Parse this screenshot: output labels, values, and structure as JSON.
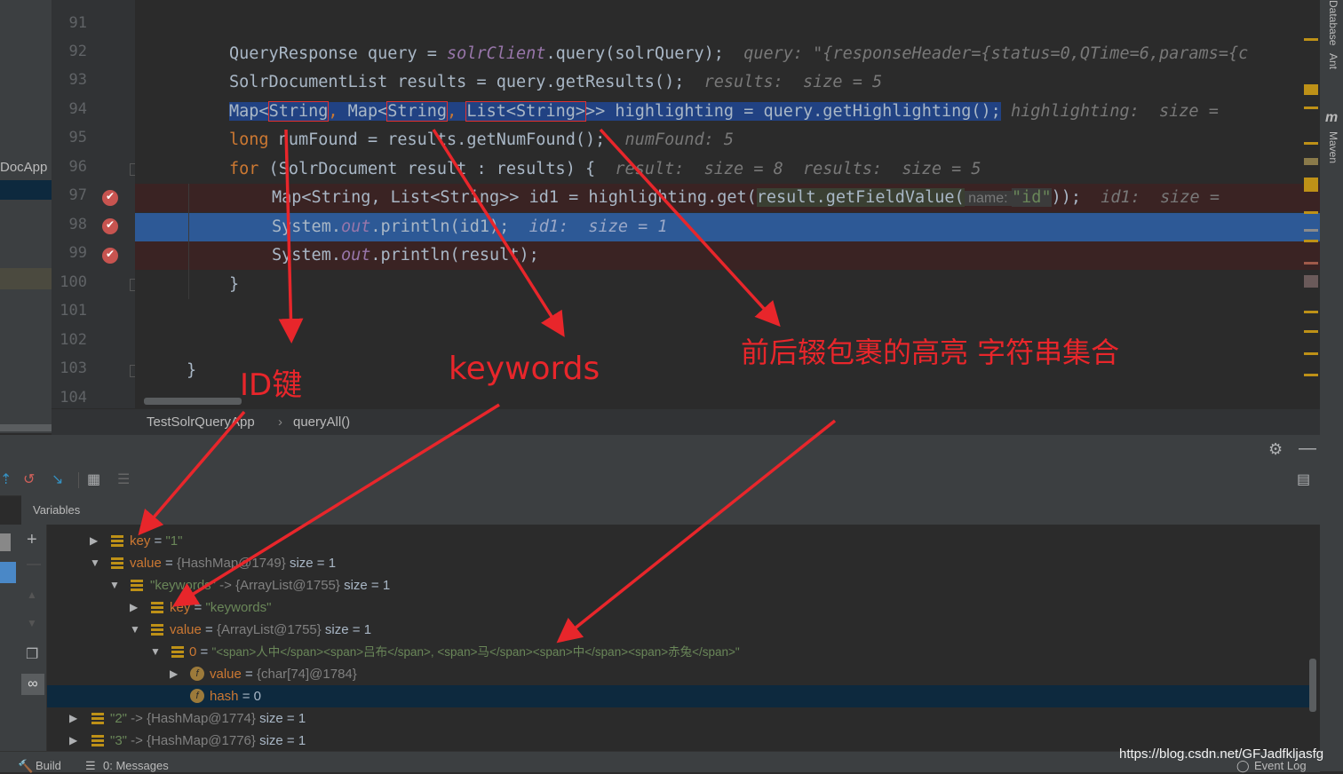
{
  "project_label": "DocApp",
  "line_numbers": [
    "91",
    "92",
    "93",
    "94",
    "95",
    "96",
    "97",
    "98",
    "99",
    "100",
    "101",
    "102",
    "103",
    "104"
  ],
  "code": {
    "l92": {
      "a": "QueryResponse query = ",
      "b": "solrClient",
      "c": ".query(solrQuery);",
      "hint": "query: \"{responseHeader={status=0,QTime=6,params={c"
    },
    "l93": {
      "a": "SolrDocumentList results = query.getResults();",
      "hint": "results:  size = 5"
    },
    "l94": {
      "t1": "Map<",
      "t2": "String",
      ",": ",",
      "t3": " Map<",
      "t4": "String",
      "t5": ", ",
      "t6": "List<String>",
      "t7": ">> highlighting = query.getHighlighting();",
      "hint": "highlighting:  size = "
    },
    "l95": {
      "kw": "long",
      "a": " numFound = results.getNumFound();",
      "hint": "numFound: 5"
    },
    "l96": {
      "kw": "for",
      "a": " (SolrDocument result : results) {",
      "hint": "result:  size = 8  results:  size = 5"
    },
    "l97": {
      "a": "Map<String, List<String>> id1 = highlighting.get(",
      "b": "result.getFieldValue(",
      "p": " name: ",
      "s": "\"id\"",
      "c": "));",
      "hint": "id1:  size = "
    },
    "l98": {
      "a": "System.",
      "b": "out",
      "c": ".println(id1);",
      "hint": "id1:  size = 1"
    },
    "l99": {
      "a": "System.",
      "b": "out",
      "c": ".println(result);"
    },
    "l100": {
      "a": "}"
    },
    "l103": {
      "a": "}"
    }
  },
  "breadcrumb": {
    "file": "TestSolrQueryApp",
    "sep": "›",
    "method": "queryAll()"
  },
  "variables_title": "Variables",
  "variables": [
    {
      "name": "key",
      "eq": " = ",
      "val": "\"1\"",
      "extra": ""
    },
    {
      "name": "value",
      "eq": " = ",
      "val": "{HashMap@1749}",
      "extra": "  size = 1"
    },
    {
      "name": "\"keywords\"",
      "eq": " -> ",
      "val": "{ArrayList@1755}",
      "extra": "  size = 1"
    },
    {
      "name": "key",
      "eq": " = ",
      "val": "\"keywords\"",
      "extra": ""
    },
    {
      "name": "value",
      "eq": " = ",
      "val": "{ArrayList@1755}",
      "extra": "  size = 1"
    },
    {
      "name": "0",
      "eq": " = ",
      "val": "\"<span>人中</span><span>吕布</span>, <span>马</span><span>中</span><span>赤兔</span>\"",
      "extra": ""
    },
    {
      "name": "value",
      "eq": " = ",
      "val": "{char[74]@1784}",
      "extra": ""
    },
    {
      "name": "hash",
      "eq": " = ",
      "val": "0",
      "extra": ""
    },
    {
      "name": "\"2\"",
      "eq": " -> ",
      "val": "{HashMap@1774}",
      "extra": "  size = 1"
    },
    {
      "name": "\"3\"",
      "eq": " -> ",
      "val": "{HashMap@1776}",
      "extra": "  size = 1"
    }
  ],
  "status": {
    "build": "Build",
    "messages": "0: Messages",
    "event_log": "Event Log"
  },
  "right_tools": [
    "Database",
    "Ant",
    "Maven"
  ],
  "annotations": {
    "id_key": "ID键",
    "keywords": "keywords",
    "highlight": "前后辍包裹的高亮  字符串集合"
  },
  "watermark": "https://blog.csdn.net/GFJadfkljasfg",
  "colors": {
    "annotation": "#e8262b",
    "selection": "#214283",
    "current_line": "#2d5996",
    "breakpoint_line": "#3a2323"
  }
}
